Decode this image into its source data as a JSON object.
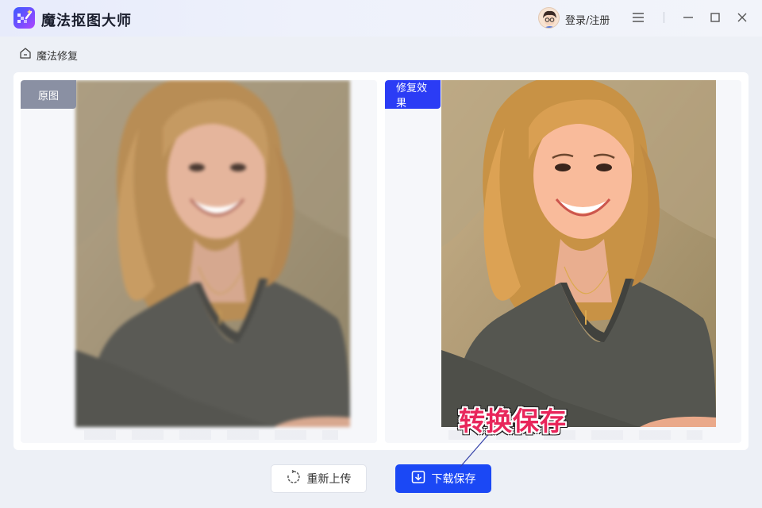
{
  "app": {
    "title": "魔法抠图大师",
    "login_label": "登录/注册"
  },
  "breadcrumb": {
    "label": "魔法修复"
  },
  "compare": {
    "left_label": "原图",
    "right_label": "修复效果"
  },
  "annotation": {
    "text": "转换保存"
  },
  "actions": {
    "reupload_label": "重新上传",
    "download_label": "下载保存"
  },
  "icons": {
    "menu": "menu-icon",
    "minimize": "minimize-icon",
    "maximize": "maximize-icon",
    "close": "close-icon",
    "home": "home-icon",
    "refresh": "refresh-icon",
    "download": "download-icon"
  },
  "colors": {
    "accent": "#1b48f5",
    "badge_original": "#8a90a3",
    "badge_result": "#2b3cf5",
    "annotation": "#e8265b"
  }
}
